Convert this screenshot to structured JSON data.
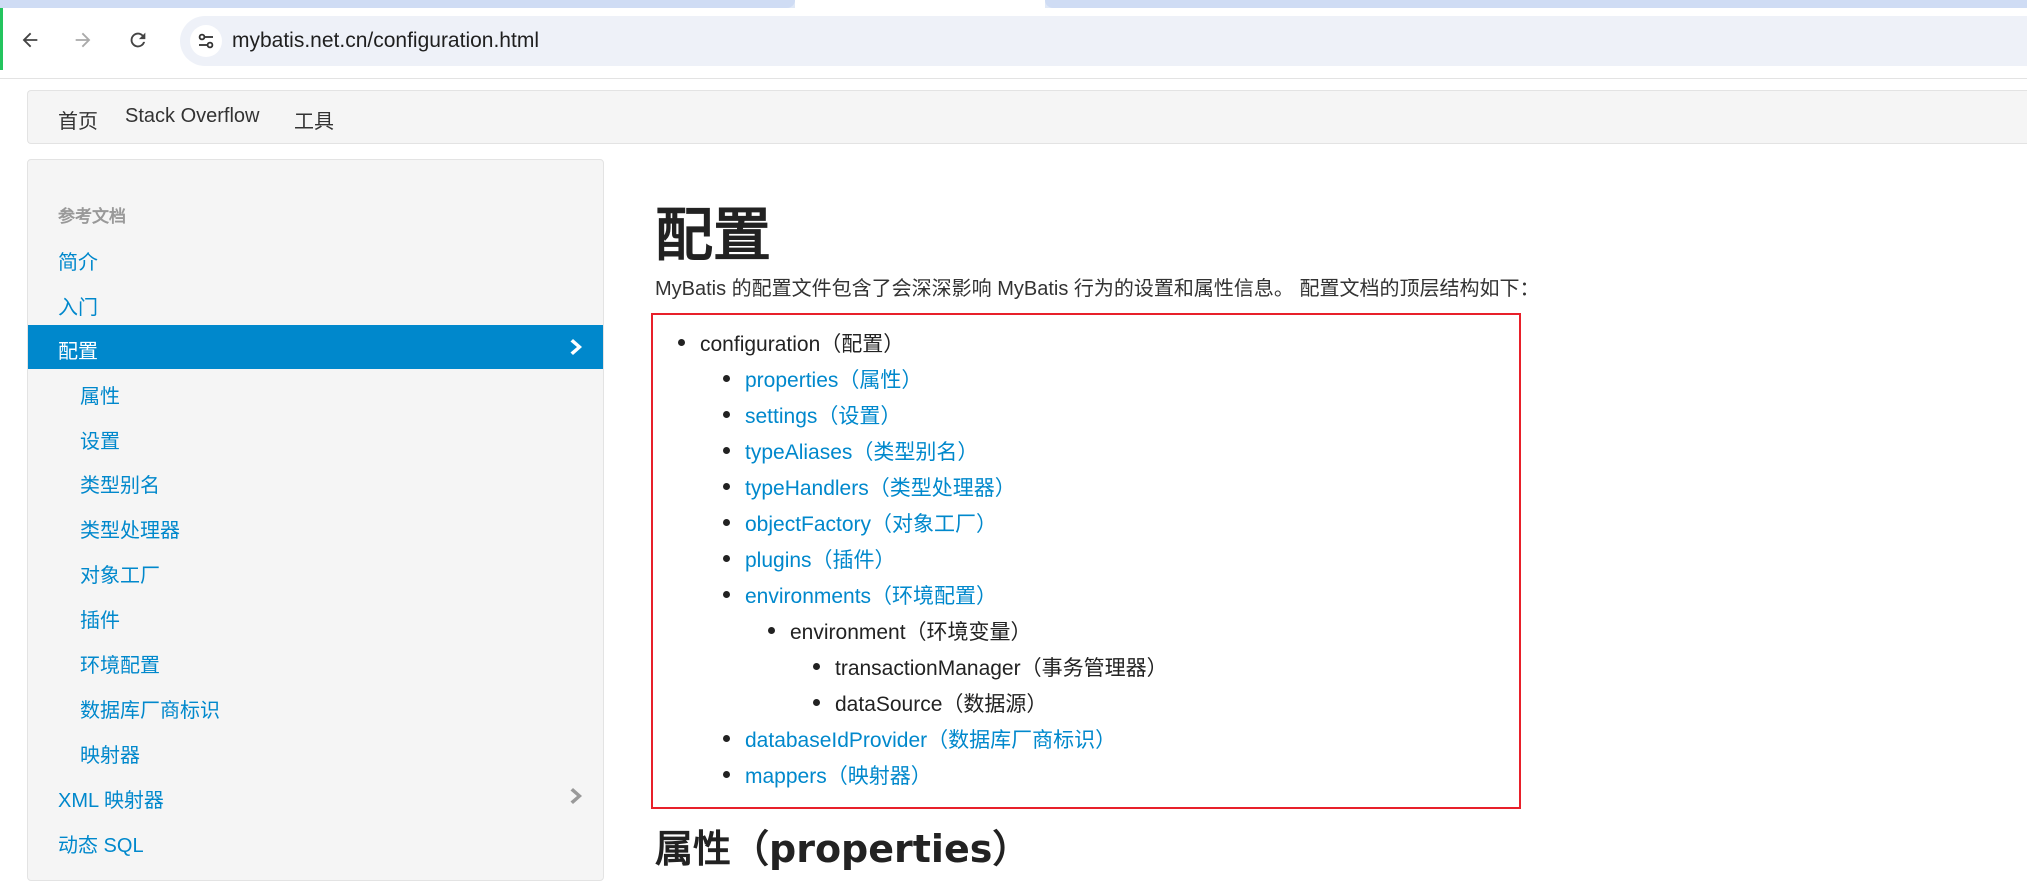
{
  "browser": {
    "url": "mybatis.net.cn/configuration.html",
    "back_icon": "arrow-left",
    "forward_icon": "arrow-right",
    "reload_icon": "reload",
    "site_info_icon": "tune-sliders"
  },
  "site_menu": {
    "items": [
      "首页",
      "Stack Overflow",
      "工具"
    ]
  },
  "sidebar": {
    "header": "参考文档",
    "items": [
      {
        "label": "简介"
      },
      {
        "label": "入门"
      },
      {
        "label": "配置"
      },
      {
        "label": "属性"
      },
      {
        "label": "设置"
      },
      {
        "label": "类型别名"
      },
      {
        "label": "类型处理器"
      },
      {
        "label": "对象工厂"
      },
      {
        "label": "插件"
      },
      {
        "label": "环境配置"
      },
      {
        "label": "数据库厂商标识"
      },
      {
        "label": "映射器"
      },
      {
        "label": "XML 映射器"
      },
      {
        "label": "动态 SQL"
      }
    ],
    "active_color": "#0088cc"
  },
  "main": {
    "title": "配置",
    "intro": "MyBatis 的配置文件包含了会深深影响 MyBatis 行为的设置和属性信息。 配置文档的顶层结构如下：",
    "tree": [
      {
        "text": "configuration（配置）",
        "link": false
      },
      {
        "text": "properties（属性）",
        "link": true
      },
      {
        "text": "settings（设置）",
        "link": true
      },
      {
        "text": "typeAliases（类型别名）",
        "link": true
      },
      {
        "text": "typeHandlers（类型处理器）",
        "link": true
      },
      {
        "text": "objectFactory（对象工厂）",
        "link": true
      },
      {
        "text": "plugins（插件）",
        "link": true
      },
      {
        "text": "environments（环境配置）",
        "link": true
      },
      {
        "text": "environment（环境变量）",
        "link": false
      },
      {
        "text": "transactionManager（事务管理器）",
        "link": false
      },
      {
        "text": "dataSource（数据源）",
        "link": false
      },
      {
        "text": "databaseIdProvider（数据库厂商标识）",
        "link": true
      },
      {
        "text": "mappers（映射器）",
        "link": true
      }
    ],
    "section_title": "属性（properties）",
    "highlight_color": "#e8202a",
    "link_color": "#0088cc"
  }
}
